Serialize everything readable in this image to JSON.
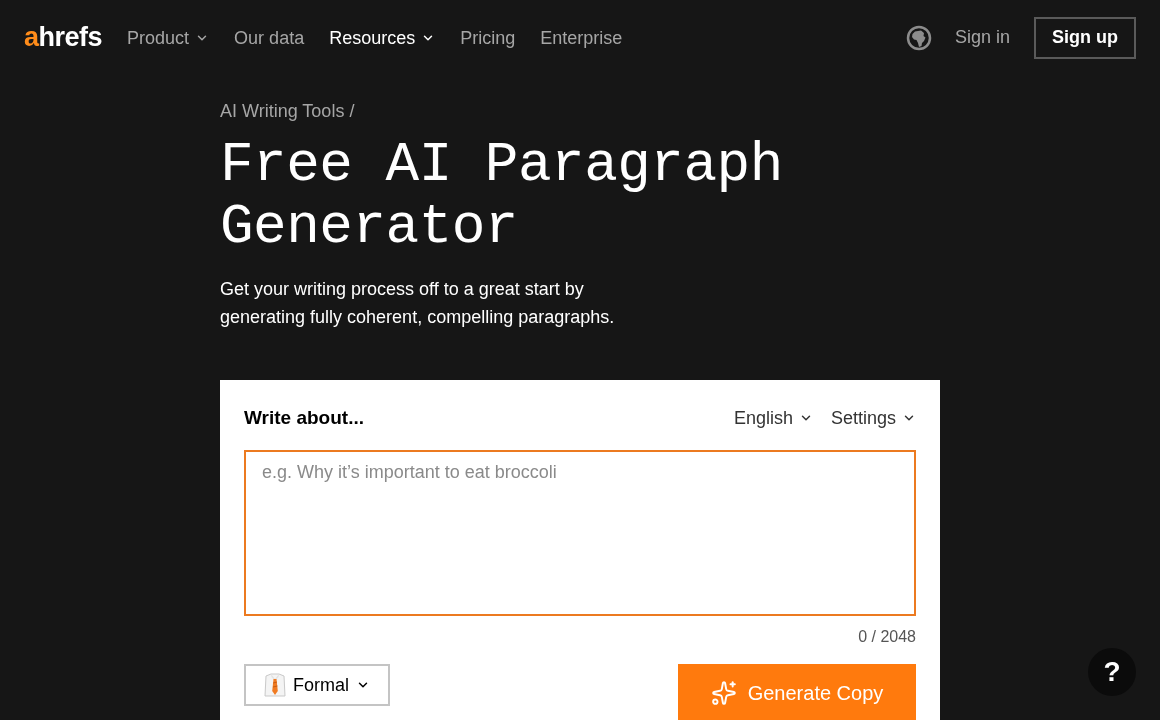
{
  "header": {
    "logo": {
      "accent": "a",
      "rest": "hrefs"
    },
    "nav": [
      {
        "label": "Product",
        "has_menu": true,
        "selected": false
      },
      {
        "label": "Our data",
        "has_menu": false,
        "selected": false
      },
      {
        "label": "Resources",
        "has_menu": true,
        "selected": true
      },
      {
        "label": "Pricing",
        "has_menu": false,
        "selected": false
      },
      {
        "label": "Enterprise",
        "has_menu": false,
        "selected": false
      }
    ],
    "sign_in": "Sign in",
    "sign_up": "Sign up"
  },
  "breadcrumb": "AI Writing Tools /",
  "title": "Free AI Paragraph Generator",
  "subtitle": "Get your writing process off to a great start by generating fully coherent, compelling paragraphs.",
  "tool": {
    "heading": "Write about...",
    "menus": [
      {
        "label": "English"
      },
      {
        "label": "Settings"
      }
    ],
    "prompt": {
      "placeholder": "e.g. Why it’s important to eat broccoli"
    },
    "counter": "0 / 2048",
    "tone": {
      "label": "Formal"
    },
    "generate": "Generate Copy"
  },
  "help": "?"
}
